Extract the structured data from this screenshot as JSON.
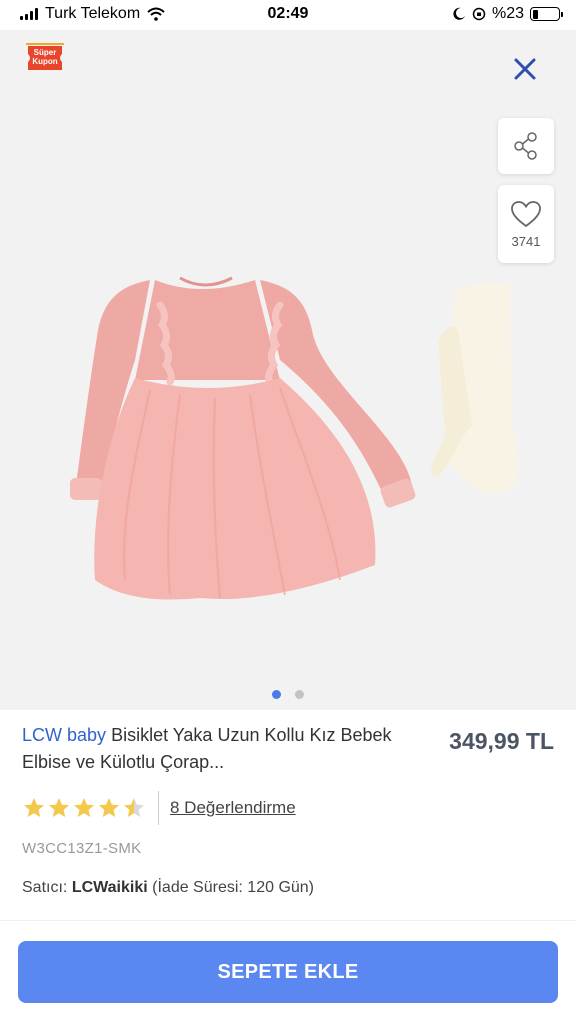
{
  "status_bar": {
    "carrier": "Turk Telekom",
    "time": "02:49",
    "battery_text": "%23",
    "battery_level": 0.23
  },
  "gallery": {
    "coupon": {
      "line1": "Süper",
      "line2": "Kupon"
    },
    "favorite_count": "3741",
    "page_count": 2,
    "active_page": 1,
    "icons": [
      "close-icon",
      "share-icon",
      "heart-icon"
    ]
  },
  "product": {
    "brand": "LCW baby",
    "title": "Bisiklet Yaka Uzun Kollu Kız Bebek Elbise ve Külotlu Çorap...",
    "price": "349,99 TL",
    "rating": 4.5,
    "reviews_label": "8 Değerlendirme",
    "sku": "W3CC13Z1-SMK",
    "seller_label": "Satıcı:",
    "seller_name": "LCWaikiki",
    "return_info": "(İade Süresi: 120 Gün)"
  },
  "cart_button_label": "SEPETE EKLE",
  "colors": {
    "accent": "#5b87f0",
    "brand_link": "#2f63cf",
    "star": "#f2c94c",
    "coupon": "#e8452c"
  }
}
